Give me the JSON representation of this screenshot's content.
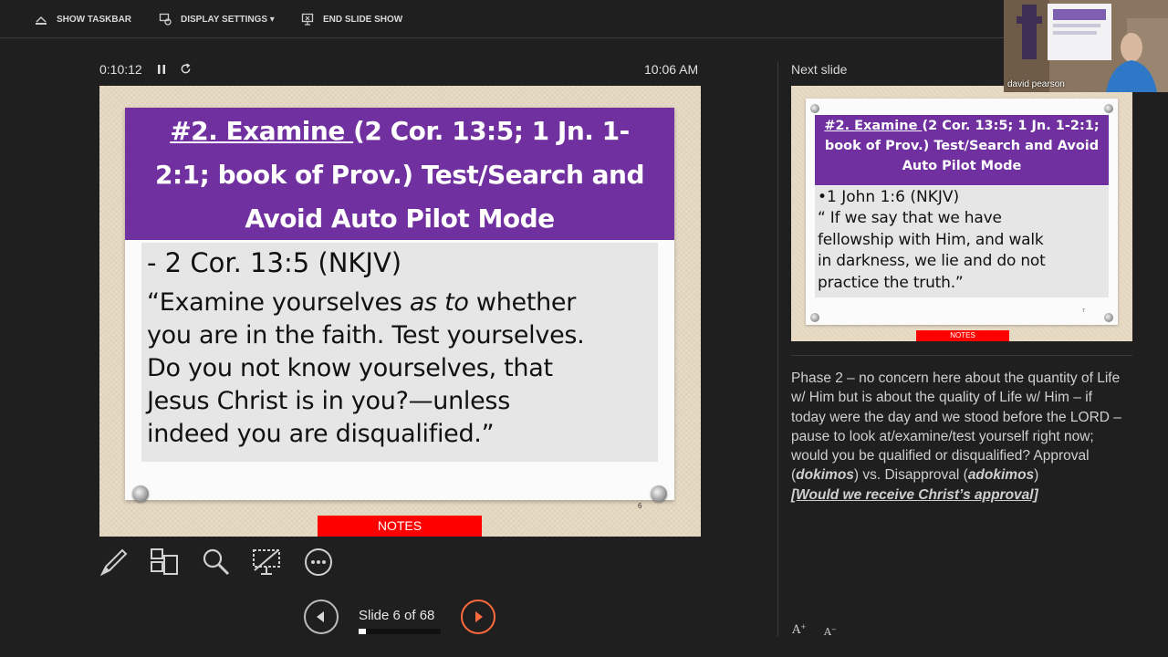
{
  "toolbar": {
    "show_taskbar": "SHOW TASKBAR",
    "display_settings": "DISPLAY SETTINGS ▾",
    "end_slide_show": "END SLIDE SHOW"
  },
  "timer": {
    "elapsed": "0:10:12",
    "clock": "10:06 AM"
  },
  "current_slide": {
    "title_underlined": "#2. Examine ",
    "title_line1_rest": "(2 Cor. 13:5; 1 Jn. 1-",
    "title_line2": "2:1; book of Prov.) Test/Search and",
    "title_line3": "Avoid Auto Pilot Mode",
    "reference": "- 2 Cor. 13:5 (NKJV)",
    "quote_line1_a": "“Examine yourselves ",
    "quote_line1_i": "as to",
    "quote_line1_b": " whether",
    "quote_line2": "you are in the faith. Test yourselves.",
    "quote_line3": "Do you not know yourselves, that",
    "quote_line4": "Jesus Christ is in you?—unless",
    "quote_line5": "indeed you are disqualified.”",
    "page_number": "6",
    "notes_label": "NOTES"
  },
  "navigation": {
    "slide_counter": "Slide 6 of 68",
    "progress": 0.088
  },
  "next_slide": {
    "label": "Next slide",
    "title_underlined": "#2. Examine ",
    "title_line1_rest": "(2 Cor. 13:5; 1 Jn. 1-2:1;",
    "title_line2": "book of Prov.) Test/Search and Avoid",
    "title_line3": "Auto Pilot Mode",
    "reference": "•1 John 1:6 (NKJV)",
    "quote_line1": "“ If we say that we have",
    "quote_line2": "fellowship with Him, and walk",
    "quote_line3": "in darkness, we lie and do not",
    "quote_line4": "practice the truth.”",
    "page_number": "7",
    "notes_label": "NOTES"
  },
  "speaker_notes": {
    "text_main": "Phase 2 – no concern here about the quantity of Life w/ Him but is about the quality of Life w/ Him – if today were the day and we stood before the LORD – pause to look at/examine/test yourself right now; would you be qualified or disqualified?  Approval (",
    "term1": "dokimos",
    "text_mid": ") vs. Disapproval (",
    "term2": "adokimos",
    "text_end": ")",
    "closing": "[Would we receive Christ’s approval]"
  },
  "font_controls": {
    "increase": "A",
    "decrease": "A"
  },
  "webcam": {
    "name": "david pearson"
  },
  "colors": {
    "slide_title_bg": "#7030a0",
    "notes_tag": "#ff0000",
    "next_button_accent": "#ff6a3d",
    "background": "#1f1f1f"
  }
}
